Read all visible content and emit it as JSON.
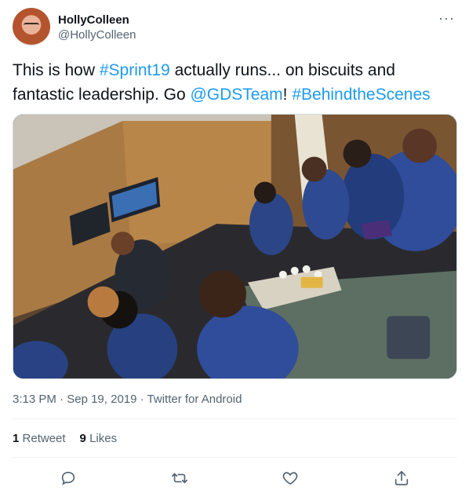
{
  "author": {
    "display_name": "HollyColleen",
    "handle": "@HollyColleen"
  },
  "more_icon": "more-horizontal-icon",
  "tweet": {
    "text_1": "This is how ",
    "hashtag_1": "#Sprint19",
    "text_2": " actually runs... on biscuits and",
    "text_3": "fantastic leadership. Go ",
    "mention": "@GDSTeam",
    "text_4": "! ",
    "hashtag_2": "#BehindtheScenes"
  },
  "meta": {
    "time": "3:13 PM",
    "separator": " · ",
    "date": "Sep 19, 2019",
    "source": "Twitter for Android"
  },
  "stats": {
    "retweet_count": "1",
    "retweet_label": "Retweet",
    "like_count": "9",
    "like_label": "Likes"
  },
  "actions": [
    "reply-icon",
    "retweet-icon",
    "like-icon",
    "share-icon"
  ],
  "colors": {
    "link": "#1d9bf0",
    "text": "#0f1419",
    "secondary": "#536471"
  }
}
